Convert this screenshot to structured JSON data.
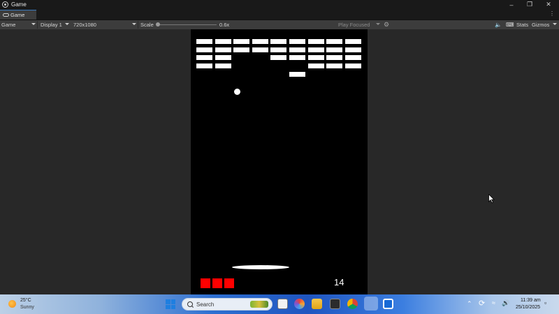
{
  "window": {
    "title": "Game",
    "controls": {
      "minimize": "–",
      "restore": "❐",
      "close": "✕"
    }
  },
  "tabs": [
    {
      "label": "Game",
      "active": true
    }
  ],
  "toolbar": {
    "view_dropdown": "Game",
    "display_dropdown": "Display 1",
    "resolution_dropdown": "720x1080",
    "scale_label": "Scale",
    "scale_value": "0.6x",
    "play_mode": "Play Focused",
    "stats_label": "Stats",
    "gizmos_label": "Gizmos"
  },
  "game": {
    "score": "14",
    "lives": 3,
    "bricks_rows": [
      [
        1,
        1,
        1,
        1,
        1,
        1,
        1,
        1,
        1
      ],
      [
        1,
        1,
        1,
        1,
        1,
        1,
        1,
        1,
        1
      ],
      [
        1,
        1,
        0,
        0,
        1,
        1,
        1,
        1,
        1
      ],
      [
        1,
        1,
        0,
        0,
        0,
        0,
        1,
        1,
        1
      ],
      [
        0,
        0,
        0,
        0,
        0,
        1,
        0,
        0,
        0
      ]
    ],
    "colors": {
      "background": "#000000",
      "brick": "#ffffff",
      "ball": "#ffffff",
      "paddle": "#ffffff",
      "life": "#ff0000",
      "score": "#ffffff"
    }
  },
  "taskbar": {
    "weather_temp": "25°C",
    "weather_desc": "Sunny",
    "search_placeholder": "Search",
    "apps": [
      "start-icon",
      "file-explorer-icon",
      "copilot-icon",
      "folder-icon",
      "terminal-icon",
      "chrome-icon",
      "unity-icon",
      "store-icon"
    ],
    "tray_icons": [
      "chevron-up-icon",
      "sync-icon",
      "wifi-icon",
      "volume-icon"
    ],
    "time": "11:39 am",
    "date": "25/10/2025"
  },
  "colors": {
    "editor_bg": "#282828",
    "toolbar_bg": "#3c3c3c",
    "titlebar_bg": "#191919",
    "accent": "#3a79bb"
  }
}
